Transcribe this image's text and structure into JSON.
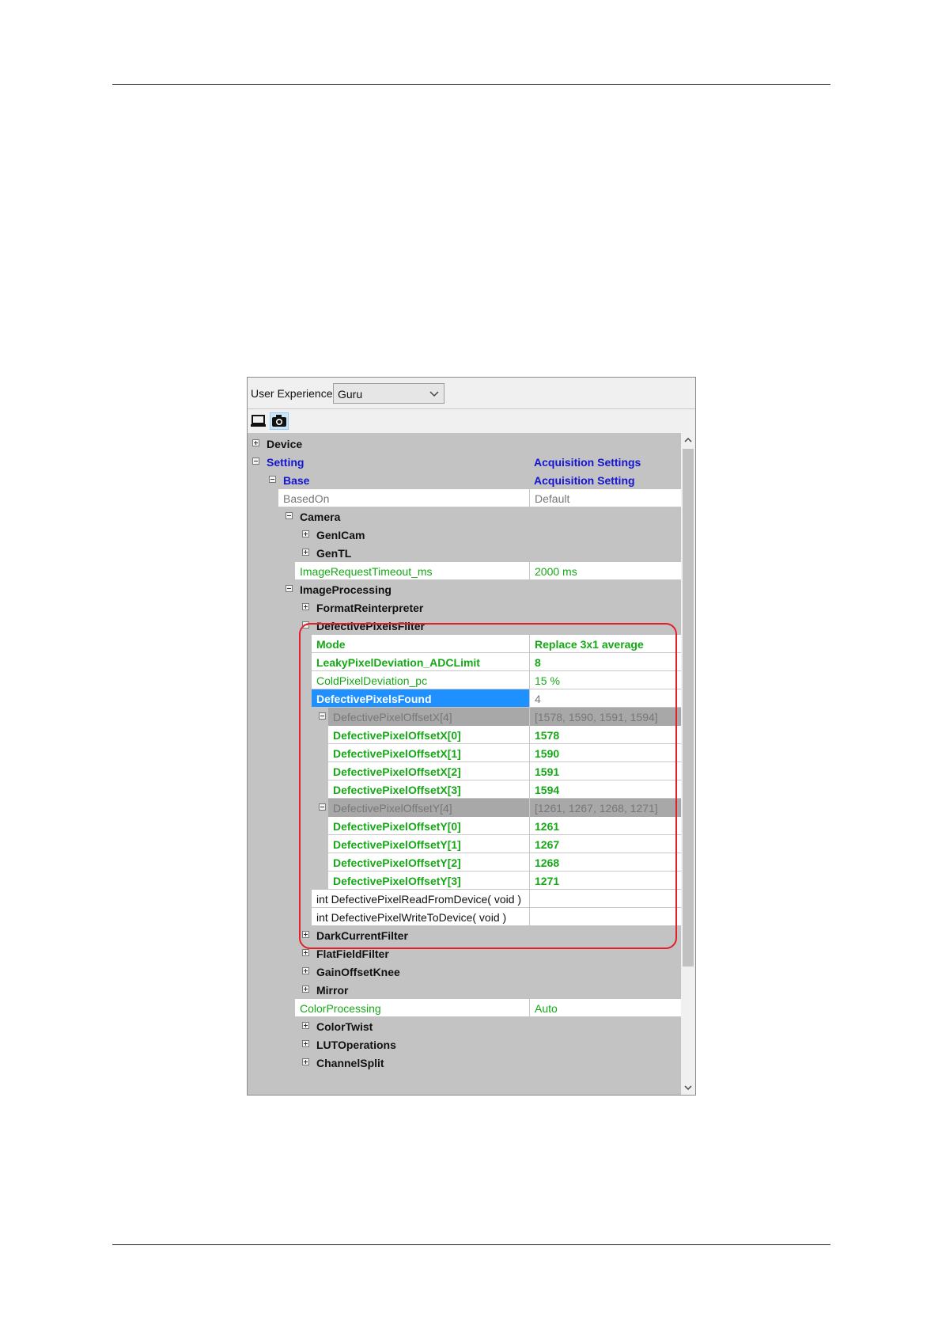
{
  "user_experience": {
    "label": "User Experience:",
    "value": "Guru"
  },
  "toolbar": {
    "buttons": [
      "device-view-icon",
      "camera-icon"
    ]
  },
  "tree": [
    {
      "name": "Device",
      "value": "",
      "indent": 0,
      "expander": "plus",
      "bold": true,
      "style": "dark",
      "bg": "gray"
    },
    {
      "name": "Setting",
      "value": "Acquisition Settings",
      "indent": 0,
      "expander": "minus",
      "bold": true,
      "style": "blue",
      "bg": "gray"
    },
    {
      "name": "Base",
      "value": "Acquisition Setting",
      "indent": 1,
      "expander": "minus",
      "bold": true,
      "style": "blue",
      "bg": "gray"
    },
    {
      "name": "BasedOn",
      "value": "Default",
      "indent": 1,
      "expander": "",
      "bold": false,
      "style": "gray",
      "bg": "white"
    },
    {
      "name": "Camera",
      "value": "",
      "indent": 2,
      "expander": "minus",
      "bold": true,
      "style": "dark",
      "bg": "gray"
    },
    {
      "name": "GenICam",
      "value": "",
      "indent": 3,
      "expander": "plus",
      "bold": true,
      "style": "dark",
      "bg": "gray"
    },
    {
      "name": "GenTL",
      "value": "",
      "indent": 3,
      "expander": "plus",
      "bold": true,
      "style": "dark",
      "bg": "gray"
    },
    {
      "name": "ImageRequestTimeout_ms",
      "value": "2000 ms",
      "indent": 2,
      "expander": "",
      "bold": false,
      "style": "green",
      "bg": "white"
    },
    {
      "name": "ImageProcessing",
      "value": "",
      "indent": 2,
      "expander": "minus",
      "bold": true,
      "style": "dark",
      "bg": "gray"
    },
    {
      "name": "FormatReinterpreter",
      "value": "",
      "indent": 3,
      "expander": "plus",
      "bold": true,
      "style": "dark",
      "bg": "gray"
    },
    {
      "name": "DefectivePixelsFilter",
      "value": "",
      "indent": 3,
      "expander": "minus",
      "bold": true,
      "style": "dark",
      "bg": "gray"
    },
    {
      "name": "Mode",
      "value": "Replace 3x1 average",
      "indent": 3,
      "expander": "",
      "bold": true,
      "style": "green",
      "bg": "white"
    },
    {
      "name": "LeakyPixelDeviation_ADCLimit",
      "value": "8",
      "indent": 3,
      "expander": "",
      "bold": true,
      "style": "green",
      "bg": "white"
    },
    {
      "name": "ColdPixelDeviation_pc",
      "value": "15 %",
      "indent": 3,
      "expander": "",
      "bold": false,
      "style": "green",
      "bg": "white"
    },
    {
      "name": "DefectivePixelsFound",
      "value": "4",
      "indent": 3,
      "expander": "",
      "bold": true,
      "style": "white",
      "bg": "selected"
    },
    {
      "name": "DefectivePixelOffsetX[4]",
      "value": "[1578, 1590, 1591, 1594]",
      "indent": 4,
      "expander": "minus",
      "bold": false,
      "style": "gray",
      "bg": "darkgray"
    },
    {
      "name": "DefectivePixelOffsetX[0]",
      "value": "1578",
      "indent": 4,
      "expander": "",
      "bold": true,
      "style": "green",
      "bg": "white"
    },
    {
      "name": "DefectivePixelOffsetX[1]",
      "value": "1590",
      "indent": 4,
      "expander": "",
      "bold": true,
      "style": "green",
      "bg": "white"
    },
    {
      "name": "DefectivePixelOffsetX[2]",
      "value": "1591",
      "indent": 4,
      "expander": "",
      "bold": true,
      "style": "green",
      "bg": "white"
    },
    {
      "name": "DefectivePixelOffsetX[3]",
      "value": "1594",
      "indent": 4,
      "expander": "",
      "bold": true,
      "style": "green",
      "bg": "white"
    },
    {
      "name": "DefectivePixelOffsetY[4]",
      "value": "[1261, 1267, 1268, 1271]",
      "indent": 4,
      "expander": "minus",
      "bold": false,
      "style": "gray",
      "bg": "darkgray"
    },
    {
      "name": "DefectivePixelOffsetY[0]",
      "value": "1261",
      "indent": 4,
      "expander": "",
      "bold": true,
      "style": "green",
      "bg": "white"
    },
    {
      "name": "DefectivePixelOffsetY[1]",
      "value": "1267",
      "indent": 4,
      "expander": "",
      "bold": true,
      "style": "green",
      "bg": "white"
    },
    {
      "name": "DefectivePixelOffsetY[2]",
      "value": "1268",
      "indent": 4,
      "expander": "",
      "bold": true,
      "style": "green",
      "bg": "white"
    },
    {
      "name": "DefectivePixelOffsetY[3]",
      "value": "1271",
      "indent": 4,
      "expander": "",
      "bold": true,
      "style": "green",
      "bg": "white"
    },
    {
      "name": "int DefectivePixelReadFromDevice( void )",
      "value": "",
      "indent": 3,
      "expander": "",
      "bold": false,
      "style": "dark",
      "bg": "white"
    },
    {
      "name": "int DefectivePixelWriteToDevice( void )",
      "value": "",
      "indent": 3,
      "expander": "",
      "bold": false,
      "style": "dark",
      "bg": "white"
    },
    {
      "name": "DarkCurrentFilter",
      "value": "",
      "indent": 3,
      "expander": "plus",
      "bold": true,
      "style": "dark",
      "bg": "gray"
    },
    {
      "name": "FlatFieldFilter",
      "value": "",
      "indent": 3,
      "expander": "plus",
      "bold": true,
      "style": "dark",
      "bg": "gray"
    },
    {
      "name": "GainOffsetKnee",
      "value": "",
      "indent": 3,
      "expander": "plus",
      "bold": true,
      "style": "dark",
      "bg": "gray"
    },
    {
      "name": "Mirror",
      "value": "",
      "indent": 3,
      "expander": "plus",
      "bold": true,
      "style": "dark",
      "bg": "gray"
    },
    {
      "name": "ColorProcessing",
      "value": "Auto",
      "indent": 2,
      "expander": "",
      "bold": false,
      "style": "green",
      "bg": "white"
    },
    {
      "name": "ColorTwist",
      "value": "",
      "indent": 3,
      "expander": "plus",
      "bold": true,
      "style": "dark",
      "bg": "gray"
    },
    {
      "name": "LUTOperations",
      "value": "",
      "indent": 3,
      "expander": "plus",
      "bold": true,
      "style": "dark",
      "bg": "gray"
    },
    {
      "name": "ChannelSplit",
      "value": "",
      "indent": 3,
      "expander": "plus",
      "bold": true,
      "style": "dark",
      "bg": "gray"
    }
  ],
  "colors": {
    "tree_background": "#c3c3c3",
    "selected": "#1e90ff",
    "highlight": "#e0202a",
    "blue_text": "#1414d2",
    "green_text": "#16a816"
  }
}
